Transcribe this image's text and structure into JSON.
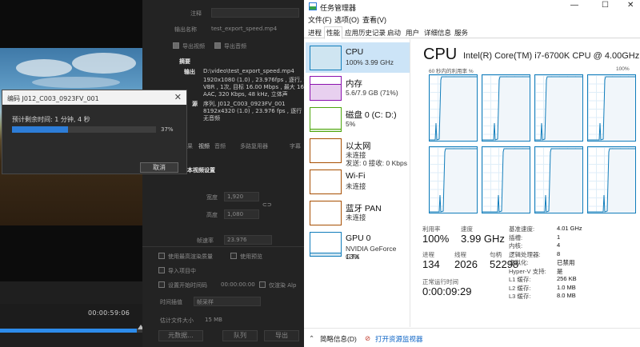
{
  "left_app": {
    "settings": {
      "comment_label": "注释",
      "output_name_label": "输出名称",
      "output_name_value": "test_export_speed.mp4",
      "export_video_label": "导出视频",
      "export_audio_label": "导出音频",
      "summary_label": "摘要",
      "output_label": "输出",
      "output_path": "D:\\video\\test_export_speed.mp4",
      "output_line2": "1920x1080 (1.0) , 23.976fps , 逐行, 软",
      "output_line3": "VBR , 1次, 目标 16.00 Mbps , 最大 16",
      "output_line4": "AAC, 320 Kbps, 48  kHz, 立体声",
      "source_label": "源",
      "source_line1": "序列, J012_C003_0923FV_001",
      "source_line2": "8192x4320 (1.0) , 23.976 fps , 逐行 , 00",
      "source_line3": "无音频",
      "tabs": [
        "果",
        "视频",
        "音频",
        "多路复用器",
        "字幕"
      ],
      "basic_video_settings": "本视频设置",
      "width_label": "宽度",
      "width_value": "1,920",
      "height_label": "高度",
      "height_value": "1,080",
      "frame_rate_label": "帧速率",
      "frame_rate_value": "23.976",
      "use_max_render_quality": "使用最高渲染质量",
      "use_preview": "使用预览",
      "import_to_project": "导入项目中",
      "set_start_timecode": "设置开始时间码",
      "timecode_value": "00:00:00:00",
      "render_alpha_only": "仅渲染 Alp",
      "time_interpolation_label": "时间插值",
      "time_interpolation_value": "帧采样",
      "estimated_file_size_label": "估计文件大小",
      "estimated_file_size_value": "15 MB",
      "metadata_button": "元数据...",
      "queue_button": "队列",
      "export_button": "导出"
    },
    "timeline": {
      "timecode": "00:00:59:06",
      "progress": 0.96
    }
  },
  "encoding_dialog": {
    "title": "编码 J012_C003_0923FV_001",
    "remaining": "预计剩余时间: 1 分钟, 4 秒",
    "progress_percent": 37,
    "progress_text": "37%",
    "cancel": "取消"
  },
  "task_manager": {
    "title": "任务管理器",
    "menu": [
      "文件(F)",
      "选项(O)",
      "查看(V)"
    ],
    "tabs": [
      "进程",
      "性能",
      "应用历史记录",
      "启动",
      "用户",
      "详细信息",
      "服务"
    ],
    "active_tab": "性能",
    "sidebar": [
      {
        "name": "CPU",
        "value1": "100% 3.99 GHz",
        "value2": "",
        "color": "#117dbb"
      },
      {
        "name": "内存",
        "value1": "5.6/7.9 GB (71%)",
        "value2": "",
        "color": "#8b12ae"
      },
      {
        "name": "磁盘 0 (C: D:)",
        "value1": "5%",
        "value2": "",
        "color": "#4da60c"
      },
      {
        "name": "以太网",
        "value1": "未连接",
        "value2": "发送: 0 接收: 0 Kbps",
        "color": "#a74f01"
      },
      {
        "name": "Wi-Fi",
        "value1": "未连接",
        "value2": "",
        "color": "#a74f01"
      },
      {
        "name": "蓝牙 PAN",
        "value1": "未连接",
        "value2": "",
        "color": "#a74f01"
      },
      {
        "name": "GPU 0",
        "value1": "NVIDIA GeForce GTX",
        "value2": "13%",
        "color": "#117dbb"
      }
    ],
    "cpu": {
      "heading": "CPU",
      "model": "Intel(R) Core(TM) i7-6700K CPU @ 4.00GHz",
      "graph_label": "60 秒内的利用率 %",
      "graph_max": "100%",
      "stats": {
        "utilization_label": "利用率",
        "utilization_value": "100%",
        "speed_label": "速度",
        "speed_value": "3.99 GHz",
        "processes_label": "进程",
        "processes_value": "134",
        "threads_label": "线程",
        "threads_value": "2026",
        "handles_label": "句柄",
        "handles_value": "52298",
        "uptime_label": "正常运行时间",
        "uptime_value": "0:00:09:29"
      },
      "details": [
        {
          "k": "基准速度:",
          "v": "4.01 GHz"
        },
        {
          "k": "插槽:",
          "v": "1"
        },
        {
          "k": "内核:",
          "v": "4"
        },
        {
          "k": "逻辑处理器:",
          "v": "8"
        },
        {
          "k": "虚拟化:",
          "v": "已禁用"
        },
        {
          "k": "Hyper-V 支持:",
          "v": "是"
        },
        {
          "k": "L1 缓存:",
          "v": "256 KB"
        },
        {
          "k": "L2 缓存:",
          "v": "1.0 MB"
        },
        {
          "k": "L3 缓存:",
          "v": "8.0 MB"
        }
      ]
    },
    "bottom": {
      "fewer_details": "简略信息(D)",
      "open_resource_monitor": "打开资源监视器"
    }
  }
}
